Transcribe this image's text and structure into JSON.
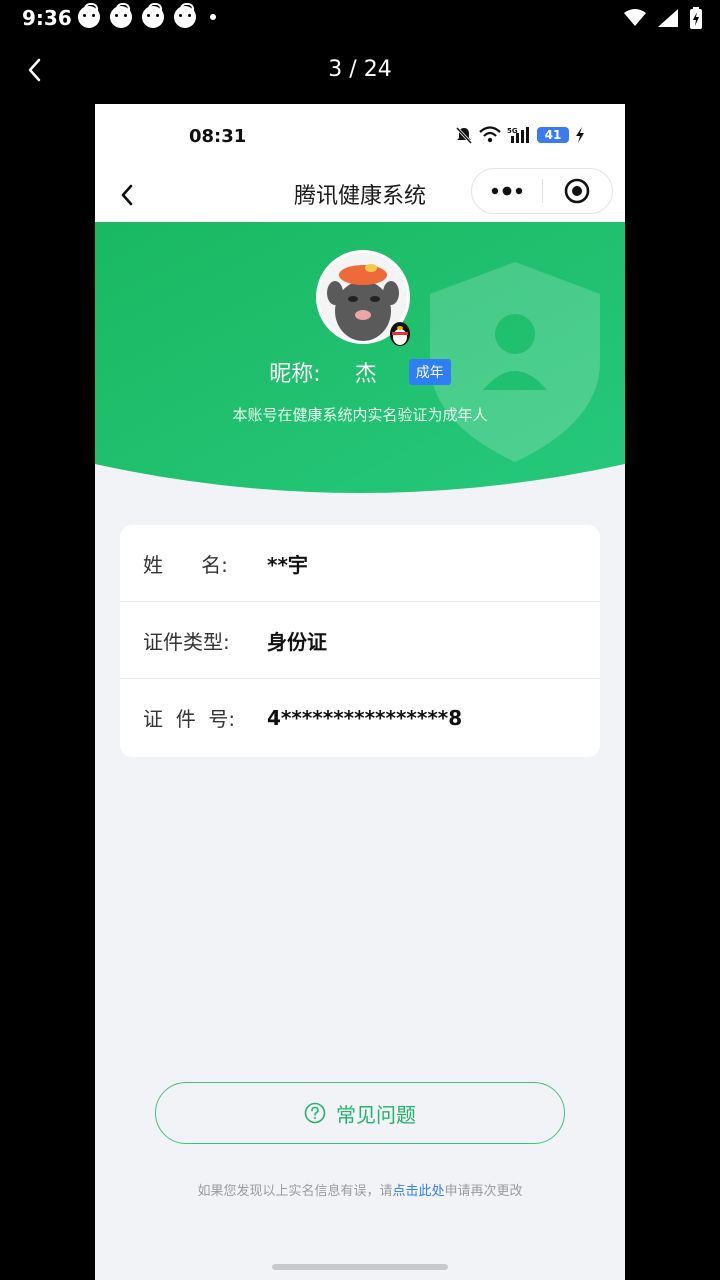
{
  "system_status": {
    "time": "9:36"
  },
  "viewer": {
    "counter": "3 / 24"
  },
  "screenshot": {
    "status_time": "08:31",
    "battery_level": "41",
    "nav_title": "腾讯健康系统",
    "nickname_label": "昵称:",
    "nickname_value": "杰",
    "adult_badge": "成年",
    "verify_desc": "本账号在健康系统内实名验证为成年人",
    "info_rows": [
      {
        "label": "姓      名:",
        "value": "**宇"
      },
      {
        "label": "证件类型:",
        "value": "身份证"
      },
      {
        "label": "证  件  号:",
        "value": "4****************8"
      }
    ],
    "faq_button": "常见问题",
    "footer_before": "如果您发现以上实名信息有误，请",
    "footer_link": "点击此处",
    "footer_after": "申请再次更改"
  },
  "colors": {
    "green": "#1fbf6a",
    "blue_badge": "#2f7ef5",
    "faq_green": "#23b36a"
  },
  "icons": [
    "back-icon",
    "more-dots-icon",
    "close-target-icon",
    "question-circle-icon",
    "qq-penguin-icon",
    "shield-icon"
  ]
}
